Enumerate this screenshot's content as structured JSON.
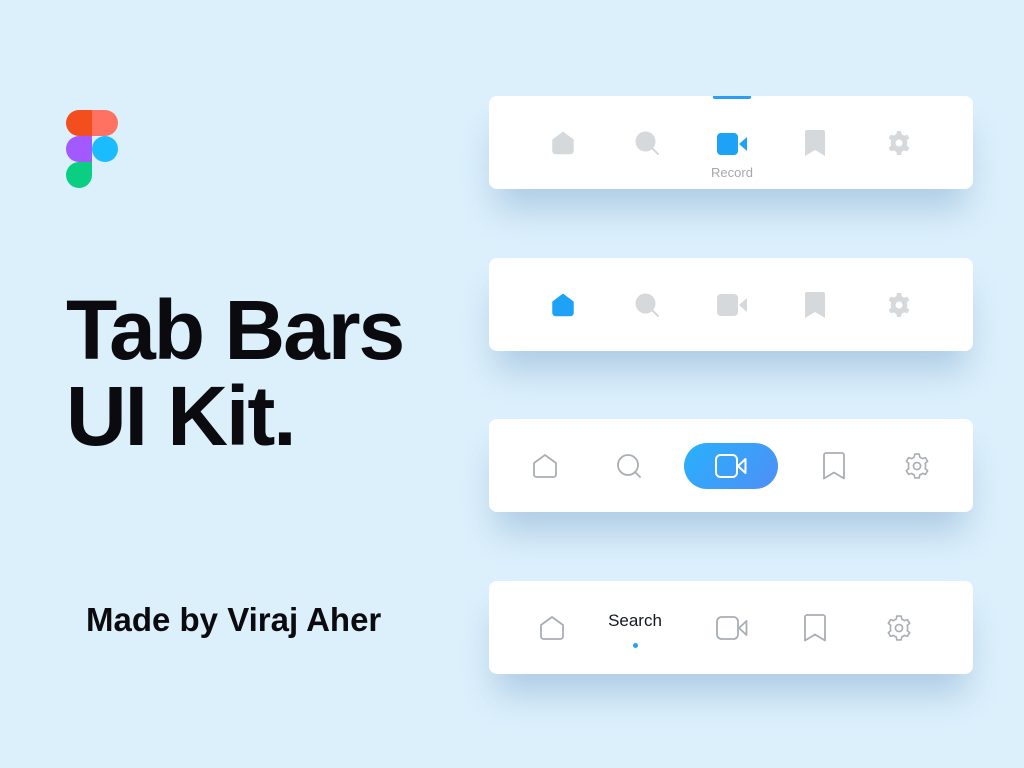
{
  "logo": {
    "name": "figma-logo",
    "colors": {
      "red": "#f24e1e",
      "salmon": "#ff7262",
      "purple": "#a259ff",
      "blue": "#1abcfe",
      "green": "#0acf83"
    }
  },
  "headline": {
    "line1": "Tab Bars",
    "line2": "UI Kit."
  },
  "byline": "Made by Viraj Aher",
  "colors": {
    "accent": "#1ea2f7",
    "inactive": "#d5d9dc",
    "outline": "#a9aeb3",
    "background": "#dcf0fc"
  },
  "tab_bars": [
    {
      "variant": "top-indicator-label",
      "active_tab": "record",
      "active_label": "Record",
      "tabs": [
        "home",
        "search",
        "record",
        "bookmark",
        "settings"
      ]
    },
    {
      "variant": "filled-active",
      "active_tab": "home",
      "tabs": [
        "home",
        "search",
        "record",
        "bookmark",
        "settings"
      ]
    },
    {
      "variant": "pill-active",
      "active_tab": "record",
      "tabs": [
        "home",
        "search",
        "record",
        "bookmark",
        "settings"
      ]
    },
    {
      "variant": "label-dot",
      "active_tab": "search",
      "active_label": "Search",
      "tabs": [
        "home",
        "search",
        "record",
        "bookmark",
        "settings"
      ]
    }
  ]
}
